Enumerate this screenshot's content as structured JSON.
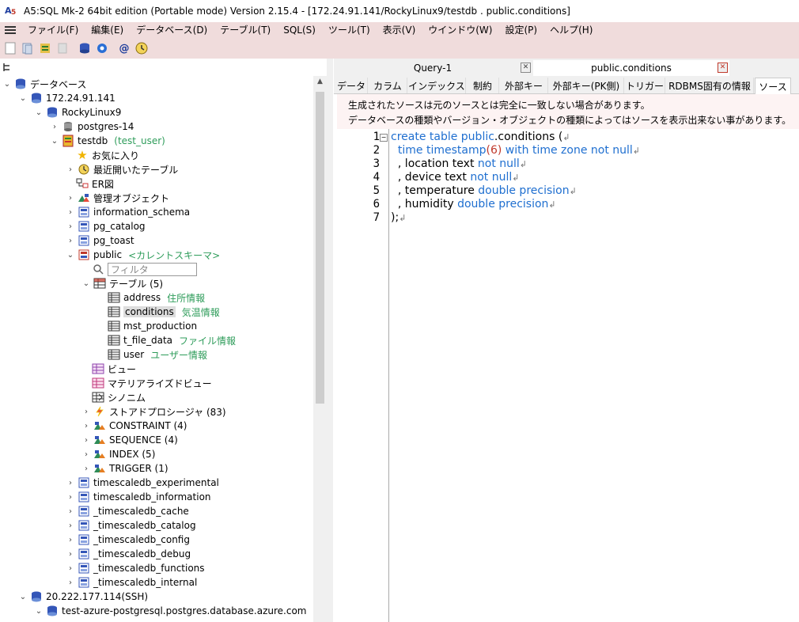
{
  "window": {
    "title": "A5:SQL Mk-2 64bit edition (Portable mode) Version 2.15.4 - [172.24.91.141/RockyLinux9/testdb . public.conditions]"
  },
  "menu": [
    "ファイル(F)",
    "編集(E)",
    "データベース(D)",
    "テーブル(T)",
    "SQL(S)",
    "ツール(T)",
    "表示(V)",
    "ウインドウ(W)",
    "設定(P)",
    "ヘルプ(H)"
  ],
  "doc_tabs": [
    {
      "label": "Query-1",
      "active": false
    },
    {
      "label": "public.conditions",
      "active": true
    }
  ],
  "sub_tabs": [
    "データ",
    "カラム",
    "インデックス",
    "制約",
    "外部キー",
    "外部キー(PK側)",
    "トリガー",
    "RDBMS固有の情報",
    "ソース"
  ],
  "active_sub_tab": "ソース",
  "notice": [
    "生成されたソースは元のソースとは完全に一致しない場合があります。",
    "データベースの種類やバージョン・オブジェクトの種類によってはソースを表示出来ない事があります。"
  ],
  "tree": [
    {
      "label": "データベース",
      "icon": "database-root-icon"
    },
    {
      "label": "172.24.91.141",
      "icon": "server-icon"
    },
    {
      "label": "RockyLinux9",
      "icon": "server-icon"
    },
    {
      "label": "postgres-14",
      "icon": "database-icon"
    },
    {
      "label": "testdb",
      "sub": "(test_user)",
      "icon": "database-active-icon"
    },
    {
      "label": "お気に入り",
      "icon": "star-icon"
    },
    {
      "label": "最近開いたテーブル",
      "icon": "clock-icon"
    },
    {
      "label": "ER図",
      "icon": "er-diagram-icon"
    },
    {
      "label": "管理オブジェクト",
      "icon": "objects-icon"
    },
    {
      "label": "information_schema",
      "icon": "schema-icon"
    },
    {
      "label": "pg_catalog",
      "icon": "schema-icon"
    },
    {
      "label": "pg_toast",
      "icon": "schema-icon"
    },
    {
      "label": "public",
      "sub": "<カレントスキーマ>",
      "icon": "schema-current-icon"
    },
    {
      "label": "フィルタ",
      "icon": "search-icon"
    },
    {
      "label": "テーブル (5)",
      "icon": "tables-folder-icon"
    },
    {
      "label": "address",
      "sub": "住所情報",
      "icon": "table-icon"
    },
    {
      "label": "conditions",
      "sub": "気温情報",
      "icon": "table-icon"
    },
    {
      "label": "mst_production",
      "icon": "table-icon"
    },
    {
      "label": "t_file_data",
      "sub": "ファイル情報",
      "icon": "table-icon"
    },
    {
      "label": "user",
      "sub": "ユーザー情報",
      "icon": "table-icon"
    },
    {
      "label": "ビュー",
      "icon": "view-icon"
    },
    {
      "label": "マテリアライズドビュー",
      "icon": "matview-icon"
    },
    {
      "label": "シノニム",
      "icon": "synonym-icon"
    },
    {
      "label": "ストアドプロシージャ (83)",
      "icon": "procedure-icon"
    },
    {
      "label": "CONSTRAINT (4)",
      "icon": "constraint-icon"
    },
    {
      "label": "SEQUENCE (4)",
      "icon": "sequence-icon"
    },
    {
      "label": "INDEX (5)",
      "icon": "index-icon"
    },
    {
      "label": "TRIGGER (1)",
      "icon": "trigger-icon"
    },
    {
      "label": "timescaledb_experimental",
      "icon": "schema-icon"
    },
    {
      "label": "timescaledb_information",
      "icon": "schema-icon"
    },
    {
      "label": "_timescaledb_cache",
      "icon": "schema-icon"
    },
    {
      "label": "_timescaledb_catalog",
      "icon": "schema-icon"
    },
    {
      "label": "_timescaledb_config",
      "icon": "schema-icon"
    },
    {
      "label": "_timescaledb_debug",
      "icon": "schema-icon"
    },
    {
      "label": "_timescaledb_functions",
      "icon": "schema-icon"
    },
    {
      "label": "_timescaledb_internal",
      "icon": "schema-icon"
    },
    {
      "label": "20.222.177.114(SSH)",
      "icon": "server-icon"
    },
    {
      "label": "test-azure-postgresql.postgres.database.azure.com",
      "icon": "server-icon"
    }
  ],
  "code": {
    "line_numbers": [
      "1",
      "2",
      "3",
      "4",
      "5",
      "6",
      "7"
    ],
    "tokens": {
      "l1": {
        "kw1": "create table public",
        "t1": ".conditions ("
      },
      "l2": {
        "kw1": "time timestamp",
        "num": "(6)",
        "kw2": " with time zone not null"
      },
      "l3": {
        "t1": ", location text ",
        "kw1": "not null"
      },
      "l4": {
        "t1": ", device text ",
        "kw1": "not null"
      },
      "l5": {
        "t1": ", temperature ",
        "kw1": "double precision"
      },
      "l6": {
        "t1": ", humidity ",
        "kw1": "double precision"
      },
      "l7": {
        "t1": ");"
      }
    },
    "return_mark": "↲"
  },
  "colors": {
    "menubar": "#f0dcdc",
    "keyword": "#1f6fd0",
    "number": "#c0392b",
    "green_label": "#2e9c5a"
  }
}
